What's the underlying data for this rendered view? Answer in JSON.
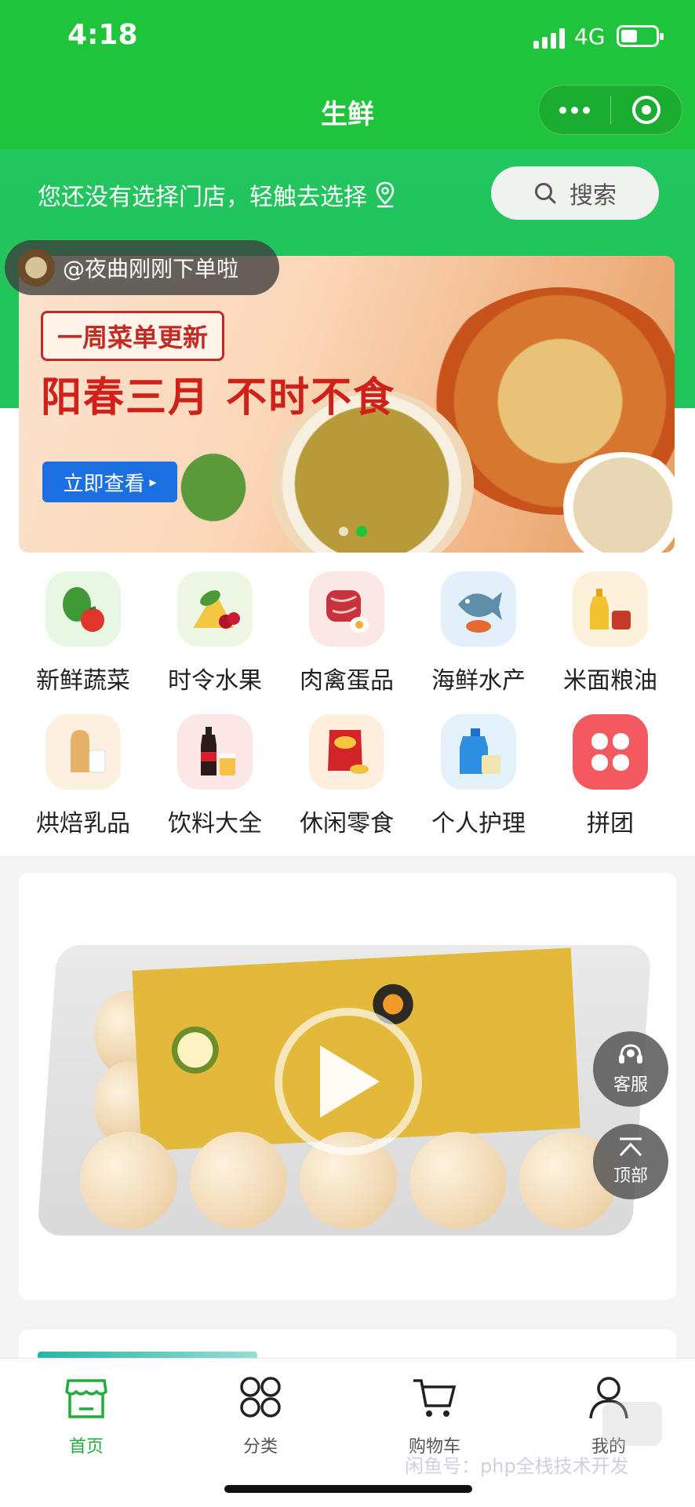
{
  "status_bar": {
    "time": "4:18",
    "network": "4G"
  },
  "nav": {
    "title": "生鲜"
  },
  "store": {
    "tip": "您还没有选择门店，轻触去选择",
    "search_label": "搜索"
  },
  "toast": {
    "text": "@夜曲刚刚下单啦"
  },
  "banner": {
    "tag": "一周菜单更新",
    "headline": "阳春三月 不时不食",
    "cta": "立即查看"
  },
  "categories": [
    {
      "label": "新鲜蔬菜",
      "icon": "vegetables-icon",
      "color": "#e8f6e4"
    },
    {
      "label": "时令水果",
      "icon": "fruit-icon",
      "color": "#eef7e4"
    },
    {
      "label": "肉禽蛋品",
      "icon": "meat-icon",
      "color": "#fbe7e4"
    },
    {
      "label": "海鲜水产",
      "icon": "seafood-icon",
      "color": "#e3f0fb"
    },
    {
      "label": "米面粮油",
      "icon": "grain-oil-icon",
      "color": "#fdf1dc"
    },
    {
      "label": "烘焙乳品",
      "icon": "bakery-dairy-icon",
      "color": "#fdf0e0"
    },
    {
      "label": "饮料大全",
      "icon": "drinks-icon",
      "color": "#fde6e6"
    },
    {
      "label": "休闲零食",
      "icon": "snacks-icon",
      "color": "#fdeede"
    },
    {
      "label": "个人护理",
      "icon": "personal-care-icon",
      "color": "#e3f1fb"
    },
    {
      "label": "拼团",
      "icon": "group-buy-icon",
      "color": "#f25a5f"
    }
  ],
  "floating": {
    "service": "客服",
    "top": "顶部"
  },
  "tabs": [
    {
      "label": "首页",
      "icon": "home-icon",
      "active": true
    },
    {
      "label": "分类",
      "icon": "category-icon",
      "active": false
    },
    {
      "label": "购物车",
      "icon": "cart-icon",
      "active": false
    },
    {
      "label": "我的",
      "icon": "profile-icon",
      "active": false
    }
  ],
  "watermark": "闲鱼号：php全栈技术开发",
  "colors": {
    "brand_green": "#1fc43a",
    "tab_active": "#1fae3b",
    "banner_red": "#d0201a",
    "cta_blue": "#1b6fe0"
  }
}
